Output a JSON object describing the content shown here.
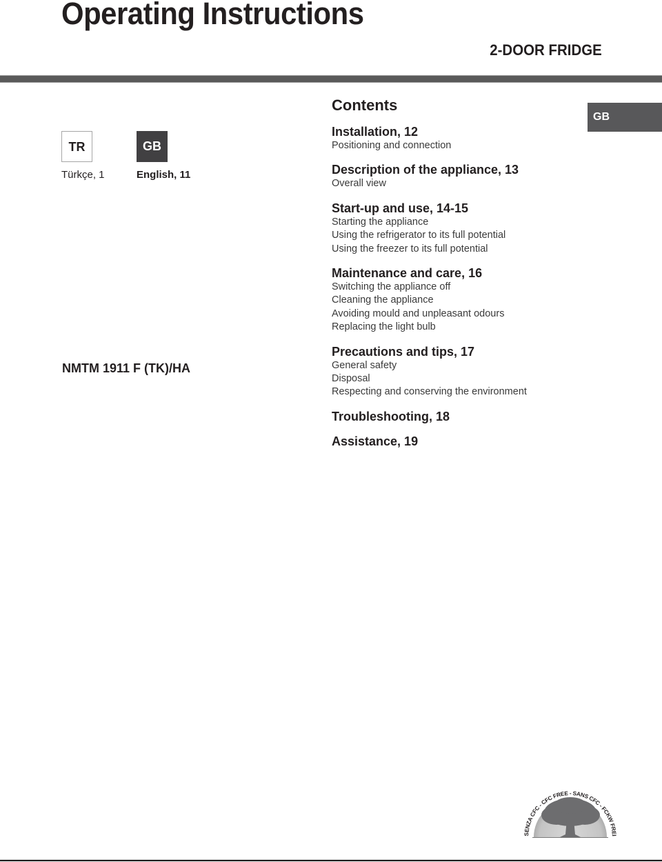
{
  "header": {
    "title": "Operating Instructions",
    "subtitle": "2-DOOR FRIDGE"
  },
  "language_tab": "GB",
  "languages": [
    {
      "code": "TR",
      "label": "Türkçe, 1",
      "active": false
    },
    {
      "code": "GB",
      "label": "English, 11",
      "active": true
    }
  ],
  "model": "NMTM 1911 F (TK)/HA",
  "contents": {
    "title": "Contents",
    "sections": [
      {
        "heading": "Installation, 12",
        "items": [
          "Positioning and connection"
        ]
      },
      {
        "heading": "Description of the appliance, 13",
        "items": [
          "Overall view"
        ]
      },
      {
        "heading": "Start-up and use, 14-15",
        "items": [
          "Starting the appliance",
          "Using the refrigerator to its full potential",
          "Using the freezer to its full potential"
        ]
      },
      {
        "heading": "Maintenance and care, 16",
        "items": [
          "Switching the appliance off",
          "Cleaning the appliance",
          "Avoiding mould and unpleasant odours",
          "Replacing the light bulb"
        ]
      },
      {
        "heading": "Precautions and tips, 17",
        "items": [
          "General safety",
          "Disposal",
          "Respecting and conserving the environment"
        ]
      },
      {
        "heading": "Troubleshooting, 18",
        "items": []
      },
      {
        "heading": "Assistance, 19",
        "items": []
      }
    ]
  },
  "logo": {
    "icon": "cfc-free-tree-logo",
    "text": "SENZA CFC - CFC FREE - SANS CFC - FCKW FREI"
  }
}
